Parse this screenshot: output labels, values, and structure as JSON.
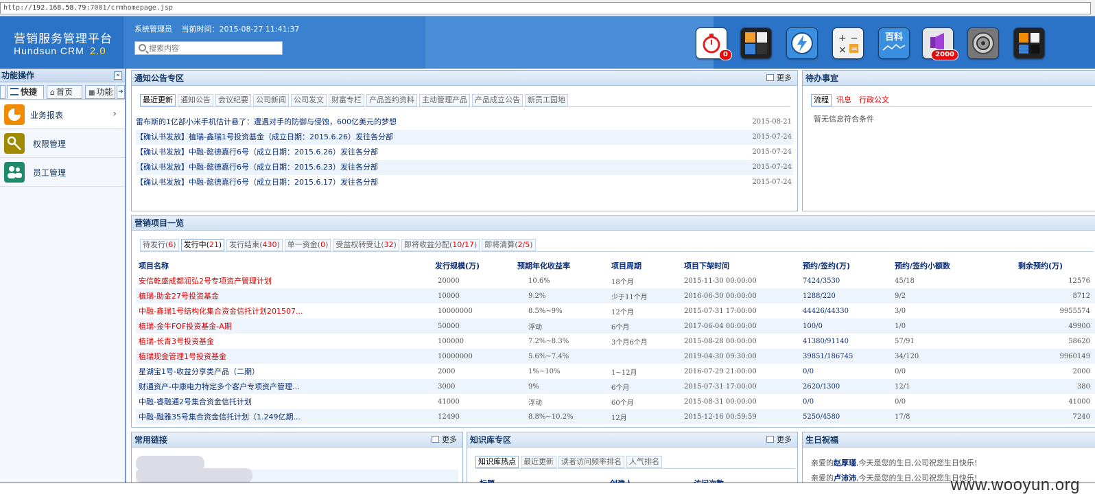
{
  "address": {
    "prefix": "http://",
    "host": "192.168.58.79",
    "rest": ":7001/crmhomepage.jsp"
  },
  "header": {
    "logo_cn": "营销服务管理平台",
    "logo_en": "Hundsun  CRM",
    "logo_ver": "2.0",
    "user": "系统管理员",
    "time_label": "当前时间：",
    "time_value": "2015-08-27 11:41:37",
    "search_placeholder": "搜索内容",
    "icons": [
      {
        "name": "stopwatch-icon",
        "color": "#ffffff",
        "badge": "0"
      },
      {
        "name": "calendar-tools-icon",
        "color": "#222222",
        "badge": ""
      },
      {
        "name": "lightning-icon",
        "color": "#3a8fe0",
        "badge": ""
      },
      {
        "name": "calculator-icon",
        "color": "#f2f2f2",
        "badge": ""
      },
      {
        "name": "wiki-icon",
        "color": "#3a8fe0",
        "label": "百科",
        "badge": ""
      },
      {
        "name": "announcement-icon",
        "color": "#e6e6e6",
        "badge": "2000"
      },
      {
        "name": "safe-dial-icon",
        "color": "#777777",
        "badge": ""
      },
      {
        "name": "tiles-icon",
        "color": "#222222",
        "badge": ""
      }
    ]
  },
  "sidebar": {
    "title": "功能操作",
    "collapse": "«",
    "tabs": [
      "快捷",
      "首页",
      "功能"
    ],
    "items": [
      {
        "label": "业务报表",
        "color": "#f08a00"
      },
      {
        "label": "权限管理",
        "color": "#a08a00"
      },
      {
        "label": "员工管理",
        "color": "#1f8a6a"
      }
    ]
  },
  "notice": {
    "title": "通知公告专区",
    "more": "更多",
    "tabs": [
      "最近更新",
      "通知公告",
      "会议纪要",
      "公司新闻",
      "公司发文",
      "财富专栏",
      "产品签约资料",
      "主动管理产品",
      "产品成立公告",
      "新员工园地"
    ],
    "items": [
      {
        "title": "雷布斯的1亿部小米手机估计悬了：遭遇对手的防御与侵蚀，600亿美元的梦想",
        "date": "2015-08-21"
      },
      {
        "title": "【确认书发放】植瑞-鑫瑞1号投资基金（成立日期：2015.6.26）发往各分部",
        "date": "2015-07-24"
      },
      {
        "title": "【确认书发放】中融-懿德嘉行6号（成立日期：2015.6.26）发往各分部",
        "date": "2015-07-24"
      },
      {
        "title": "【确认书发放】中融-懿德嘉行6号（成立日期：2015.6.23）发往各分部",
        "date": "2015-07-24"
      },
      {
        "title": "【确认书发放】中融-懿德嘉行6号（成立日期：2015.6.17）发往各分部",
        "date": "2015-07-24"
      }
    ]
  },
  "todo": {
    "title": "待办事宜",
    "tabs": [
      "流程",
      "讯息",
      "行政公文"
    ],
    "empty": "暂无信息符合条件"
  },
  "projects": {
    "title": "营销项目一览",
    "tabs": [
      {
        "label": "待发行",
        "count": "6"
      },
      {
        "label": "发行中",
        "count": "21"
      },
      {
        "label": "发行结束",
        "count": "430"
      },
      {
        "label": "单一资金",
        "count": "0"
      },
      {
        "label": "受益权转受让",
        "count": "32"
      },
      {
        "label": "即将收益分配",
        "count": "10/17"
      },
      {
        "label": "即将清算",
        "count": "2/5"
      }
    ],
    "columns": [
      "项目名称",
      "发行规模(万)",
      "预期年化收益率",
      "项目周期",
      "项目下架时间",
      "预约/签约(万)",
      "预约/签约小额数",
      "剩余预约(万)"
    ],
    "rows": [
      {
        "name": "安信乾盛成都润弘2号专项资产管理计划",
        "red": true,
        "scale": "20000",
        "rate": "10.6%",
        "period": "18个月",
        "end": "2015-11-30 00:00:00",
        "sign": "7424/3530",
        "small": "45/18",
        "remain": "12576"
      },
      {
        "name": "植瑞-助金27号投资基金",
        "red": true,
        "scale": "10000",
        "rate": "9.2%",
        "period": "少于11个月",
        "end": "2016-06-30 00:00:00",
        "sign": "1288/220",
        "small": "9/2",
        "remain": "8712"
      },
      {
        "name": "中融-鑫瑞1号结构化集合资金信托计划201507...",
        "red": true,
        "scale": "10000000",
        "rate": "8.5%~9%",
        "period": "12个月",
        "end": "2015-07-31 17:00:00",
        "sign": "44426/44330",
        "small": "3/0",
        "remain": "9955574"
      },
      {
        "name": "植瑞-金牛FOF投资基金-A期",
        "red": true,
        "scale": "50000",
        "rate": "浮动",
        "period": "6个月",
        "end": "2017-06-04 00:00:00",
        "sign": "100/0",
        "small": "1/0",
        "remain": "49900"
      },
      {
        "name": "植瑞-长青3号投资基金",
        "red": true,
        "scale": "100000",
        "rate": "7.2%~8.3%",
        "period": "3个月6个月",
        "end": "2015-08-28 00:00:00",
        "sign": "41380/91140",
        "small": "57/91",
        "remain": "58620"
      },
      {
        "name": "植瑞现金管理1号投资基金",
        "red": true,
        "scale": "10000000",
        "rate": "5.6%~7.4%",
        "period": "",
        "end": "2019-04-30 09:30:00",
        "sign": "39851/186745",
        "small": "34/120",
        "remain": "9960149"
      },
      {
        "name": "星湖宝1号-收益分享类产品（二期）",
        "red": false,
        "scale": "2000",
        "rate": "1%~10%",
        "period": "1~12月",
        "end": "2016-07-29 21:00:00",
        "sign": "0/0",
        "small": "0/0",
        "remain": "2000"
      },
      {
        "name": "财通资产-中康电力特定多个客户专项资产管理...",
        "red": false,
        "scale": "3000",
        "rate": "9%",
        "period": "6个月",
        "end": "2015-07-31 17:00:00",
        "sign": "2620/1300",
        "small": "12/1",
        "remain": "380"
      },
      {
        "name": "中融-睿融通2号集合资金信托计划",
        "red": false,
        "scale": "41000",
        "rate": "浮动",
        "period": "60个月",
        "end": "2015-08-31 00:00:00",
        "sign": "0/0",
        "small": "0/0",
        "remain": "41000"
      },
      {
        "name": "中融-融雅35号集合资金信托计划（1.249亿期...",
        "red": false,
        "scale": "12490",
        "rate": "8.8%~10.2%",
        "period": "12月",
        "end": "2015-12-16 00:59:59",
        "sign": "5250/4580",
        "small": "17/8",
        "remain": "7240"
      }
    ]
  },
  "links": {
    "title": "常用链接",
    "more": "更多"
  },
  "knowledge": {
    "title": "知识库专区",
    "more": "更多",
    "tabs": [
      "知识库热点",
      "最近更新",
      "读者访问频率排名",
      "人气排名"
    ],
    "columns": [
      "标题",
      "创建人",
      "访问次数"
    ]
  },
  "birthday": {
    "title": "生日祝福",
    "items": [
      {
        "pre": "亲爱的",
        "name": "赵厚瑾",
        "post": ",今天是您的生日,公司祝您生日快乐!"
      },
      {
        "pre": "亲爱的",
        "name": "卢沛沛",
        "post": ",今天是您的生日,公司祝您生日快乐!"
      }
    ]
  },
  "watermark": "www.wooyun.org"
}
